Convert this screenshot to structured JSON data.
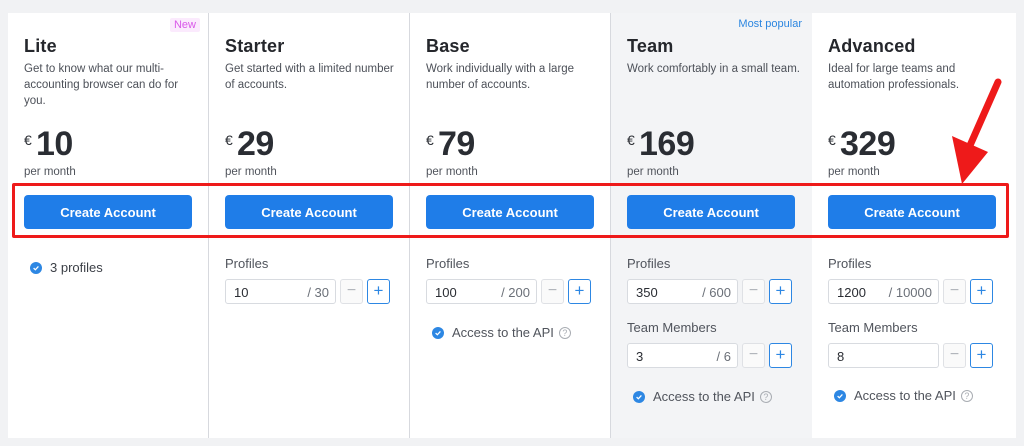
{
  "colors": {
    "accent": "#1f7de8",
    "highlight": "#ee1a1a",
    "new_badge": "#d957e9",
    "popular_badge": "#2c86e0"
  },
  "icons": {
    "check": "check-circle-icon",
    "help": "help-circle-icon",
    "arrow": "red-arrow-icon"
  },
  "plans": [
    {
      "name": "Lite",
      "badge": "New",
      "description": "Get to know what our multi-accounting browser can do for you.",
      "currency": "€",
      "price": "10",
      "period": "per month",
      "button_label": "Create Account",
      "profiles_text": "3 profiles"
    },
    {
      "name": "Starter",
      "description": "Get started with a limited number of accounts.",
      "currency": "€",
      "price": "29",
      "period": "per month",
      "button_label": "Create Account",
      "profiles_label": "Profiles",
      "profiles_value": "10",
      "profiles_max": "/ 30"
    },
    {
      "name": "Base",
      "description": "Work individually with a large number of accounts.",
      "currency": "€",
      "price": "79",
      "period": "per month",
      "button_label": "Create Account",
      "profiles_label": "Profiles",
      "profiles_value": "100",
      "profiles_max": "/ 200",
      "api_label": "Access to the API"
    },
    {
      "name": "Team",
      "badge": "Most popular",
      "description": "Work comfortably in a small team.",
      "currency": "€",
      "price": "169",
      "period": "per month",
      "button_label": "Create Account",
      "profiles_label": "Profiles",
      "profiles_value": "350",
      "profiles_max": "/ 600",
      "members_label": "Team Members",
      "members_value": "3",
      "members_max": "/ 6",
      "api_label": "Access to the API"
    },
    {
      "name": "Advanced",
      "description": "Ideal for large teams and automation professionals.",
      "currency": "€",
      "price": "329",
      "period": "per month",
      "button_label": "Create Account",
      "profiles_label": "Profiles",
      "profiles_value": "1200",
      "profiles_max": "/ 10000",
      "members_label": "Team Members",
      "members_value": "8",
      "api_label": "Access to the API"
    }
  ],
  "stepper": {
    "minus": "−",
    "plus": "+"
  },
  "help_glyph": "?"
}
